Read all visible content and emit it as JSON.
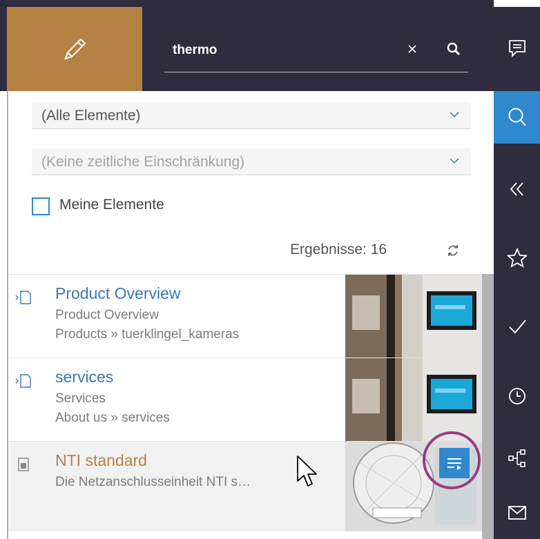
{
  "search": {
    "query": "thermo"
  },
  "filters": [
    {
      "label": "(Alle Elemente)"
    },
    {
      "label": "(Keine zeitliche Einschränkung)"
    }
  ],
  "my_elements": {
    "label": "Meine Elemente",
    "checked": false
  },
  "results_count": {
    "text": "Ergebnisse: 16"
  },
  "results": [
    {
      "title": "Product Overview",
      "subtitle": "Product Overview",
      "path": "Products » tuerklingel_kameras",
      "icon": "page-icon"
    },
    {
      "title": "services",
      "subtitle": "Services",
      "path": "About us » services",
      "icon": "page-icon"
    },
    {
      "title": "NTI standard",
      "subtitle": "Die Netzanschlusseinheit NTI s…",
      "path": "",
      "icon": "document-icon"
    }
  ],
  "rail": [
    "chat-icon",
    "search-icon",
    "collapse-icon",
    "star-icon",
    "check-icon",
    "clock-icon",
    "sitemap-icon",
    "mail-icon"
  ],
  "colors": {
    "dark": "#2e2c3e",
    "accent": "#2f89cc",
    "brand": "#b58244",
    "highlight": "#993c83"
  }
}
